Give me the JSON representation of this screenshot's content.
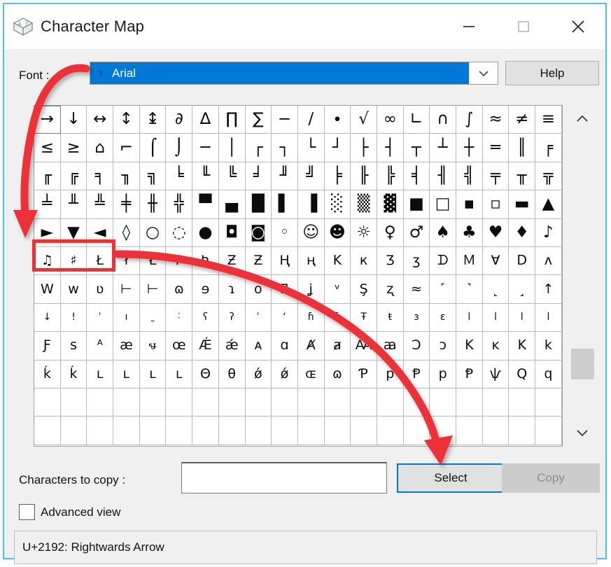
{
  "window": {
    "title": "Character Map",
    "app_icon": "character-map-icon",
    "border_color": "#4fc1e9",
    "controls": {
      "minimize": "—",
      "maximize": "☐",
      "close": "✕"
    }
  },
  "font_row": {
    "label": "Font :",
    "selected_font": "Arial",
    "font_icon": "truetype-font-icon",
    "dropdown_arrow": "∨",
    "help_label": "Help",
    "selection_color": "#0078d7"
  },
  "grid": {
    "columns": 20,
    "rows": 12,
    "selected_index": 0,
    "highlight_box": {
      "color": "#ec3237",
      "cells": [
        80,
        81,
        82
      ]
    },
    "cells": [
      "→",
      "↓",
      "↔",
      "↕",
      "↨",
      "∂",
      "∆",
      "∏",
      "∑",
      "−",
      "∕",
      "∙",
      "√",
      "∞",
      "∟",
      "∩",
      "∫",
      "≈",
      "≠",
      "≡",
      "≤",
      "≥",
      "⌂",
      "⌐",
      "⌠",
      "⌡",
      "─",
      "│",
      "┌",
      "┐",
      "└",
      "┘",
      "├",
      "┤",
      "┬",
      "┴",
      "┼",
      "═",
      "║",
      "╒",
      "╓",
      "╔",
      "╕",
      "╖",
      "╗",
      "╘",
      "╙",
      "╚",
      "╛",
      "╜",
      "╝",
      "╞",
      "╟",
      "╠",
      "╡",
      "╢",
      "╣",
      "╤",
      "╥",
      "╦",
      "╧",
      "╨",
      "╩",
      "╪",
      "╫",
      "╬",
      "▀",
      "▄",
      "█",
      "▌",
      "▐",
      "░",
      "▒",
      "▓",
      "■",
      "□",
      "▪",
      "▫",
      "▬",
      "▲",
      "►",
      "▼",
      "◄",
      "◊",
      "○",
      "◌",
      "●",
      "◘",
      "◙",
      "◦",
      "☺",
      "☻",
      "☼",
      "♀",
      "♂",
      "♠",
      "♣",
      "♥",
      "♦",
      "♪",
      "♫",
      "♯",
      "Ł",
      "ł",
      "Ł",
      "Ƥ",
      "Ʀ",
      "Ƶ",
      "Ƶ",
      "Ң",
      "ң",
      "K",
      "к",
      "Ʒ",
      "ʒ",
      "ᗪ",
      "Ｍ",
      "Ɐ",
      "ᗞ",
      "ʌ",
      "W",
      "w",
      "ʋ",
      "⊢",
      "⊢",
      "ɷ",
      "ɘ",
      "ɿ",
      "ᴏ",
      "Ǝ",
      "ʝ",
      "ᵛ",
      "Ş",
      "ʐ",
      "≈",
      "˹",
      "˺",
      "˻",
      "˼",
      "↑",
      "↓",
      "!",
      "ˈ",
      "ı",
      "˷",
      "˸",
      "ʕ",
      "ʔ",
      "ʿ",
      "ʻ",
      "ɦ",
      "ɦ",
      "Ŧ",
      "ŧ",
      "ɜ",
      "ɛ",
      "ӏ",
      "ӏ",
      "ӏ",
      "ӏ",
      "Ƒ",
      "s",
      "ᴬ",
      "æ",
      "ꮰ",
      "œ",
      "Ǽ",
      "ǽ",
      "ᴀ",
      "ɑ",
      "Ⱥ",
      "ⱥ",
      "Ꜳ",
      "ꜳ",
      "Ɔ",
      "ɔ",
      "K",
      "ᴋ",
      "K",
      "k",
      "ḱ",
      "ḱ",
      "ʟ",
      "ʟ",
      "ʟ",
      "ʟ",
      "Θ",
      "θ",
      "ǿ",
      "ǿ",
      "ɶ",
      "ɷ",
      "Ƥ",
      "р",
      "Ᵽ",
      "р",
      "Ᵽ",
      "ѱ",
      "Q",
      "q"
    ]
  },
  "scrollbar": {
    "up_arrow": "˄",
    "down_arrow": "˅",
    "thumb_position": "71%"
  },
  "bottom": {
    "chars_label": "Characters to copy :",
    "chars_value": "",
    "chars_placeholder": "",
    "select_label": "Select",
    "copy_label": "Copy",
    "copy_disabled": true,
    "advanced_label": "Advanced view",
    "advanced_checked": false
  },
  "status": {
    "text": "U+2192: Rightwards Arrow"
  },
  "annotations": {
    "arrow_color": "#ec3237",
    "arrow1": "font-dropdown-to-grid-arrow",
    "arrow2": "grid-selection-to-select-button-arrow",
    "arrow3": "pointer-down-to-select-button-arrow"
  }
}
